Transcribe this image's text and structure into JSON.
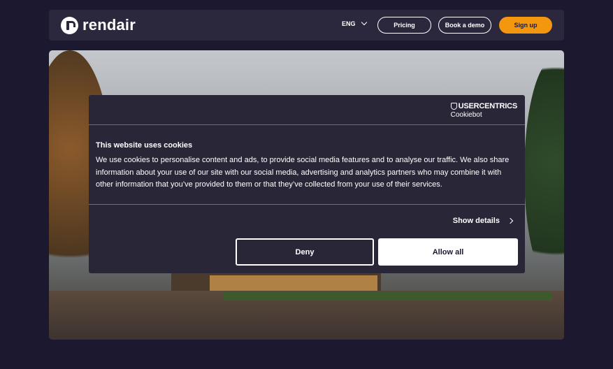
{
  "nav": {
    "logo_text": "rendair",
    "language": "ENG",
    "pricing_label": "Pricing",
    "demo_label": "Book a demo",
    "signup_label": "Sign up",
    "colors": {
      "background": "#2b283e",
      "accent": "#f5960f"
    }
  },
  "cookie_banner": {
    "brand_top": "USERCENTRICS",
    "brand_sub": "Cookiebot",
    "title": "This website uses cookies",
    "body": "We use cookies to personalise content and ads, to provide social media features and to analyse our traffic. We also share information about your use of our site with our social media, advertising and analytics partners who may combine it with other information that you’ve provided to them or that they’ve collected from your use of their services.",
    "show_details_label": "Show details",
    "deny_label": "Deny",
    "allow_all_label": "Allow all"
  },
  "icons": {
    "lang_dropdown": "chevron-down-icon",
    "show_details": "chevron-right-icon",
    "brand": "shield-icon"
  }
}
